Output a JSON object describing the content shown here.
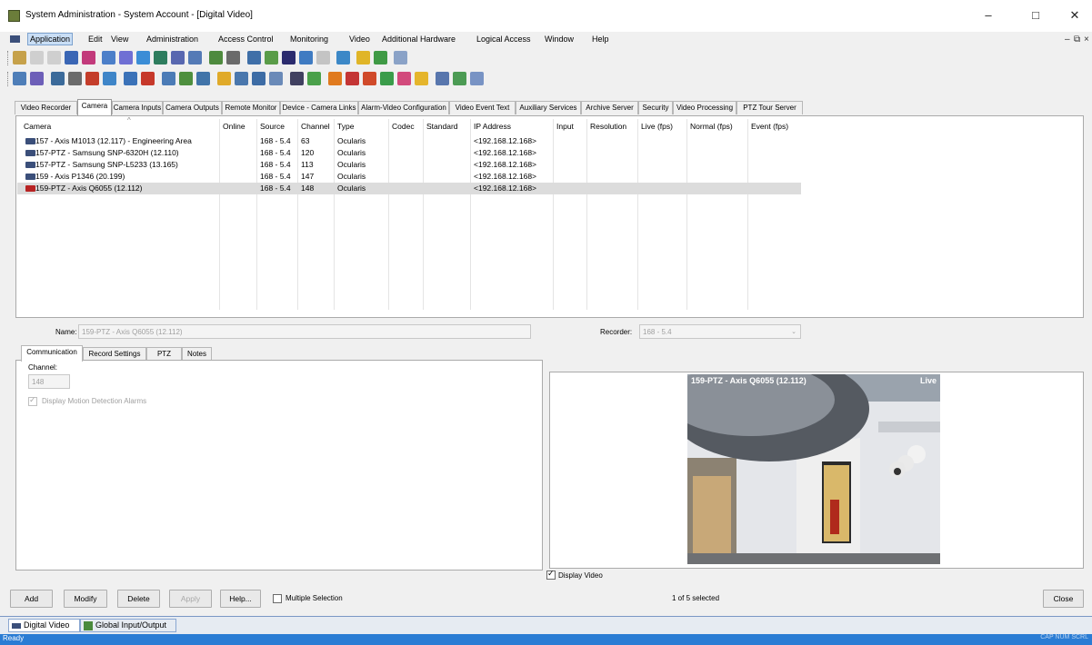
{
  "window": {
    "title": "System Administration - System Account - [Digital Video]"
  },
  "menu": [
    "Application",
    "Edit",
    "View",
    "Administration",
    "Access Control",
    "Monitoring",
    "Video",
    "Additional Hardware",
    "Logical Access",
    "Window",
    "Help"
  ],
  "tabs": [
    "Video Recorder",
    "Camera",
    "Camera Inputs",
    "Camera Outputs",
    "Remote Monitor",
    "Device - Camera Links",
    "Alarm-Video Configuration",
    "Video Event Text",
    "Auxiliary Services",
    "Archive Server",
    "Security",
    "Video Processing",
    "PTZ Tour Server"
  ],
  "table": {
    "headers": [
      "Camera",
      "Online",
      "Source",
      "Channel",
      "Type",
      "Codec",
      "Standard",
      "IP Address",
      "Input",
      "Resolution",
      "Live (fps)",
      "Normal (fps)",
      "Event (fps)"
    ],
    "rows": [
      {
        "camera": "157 - Axis M1013 (12.117) - Engineering Area",
        "source": "168 - 5.4",
        "channel": "63",
        "type": "Ocularis",
        "ip": "<192.168.12.168>"
      },
      {
        "camera": "157-PTZ - Samsung SNP-6320H (12.110)",
        "source": "168 - 5.4",
        "channel": "120",
        "type": "Ocularis",
        "ip": "<192.168.12.168>"
      },
      {
        "camera": "157-PTZ - Samsung SNP-L5233 (13.165)",
        "source": "168 - 5.4",
        "channel": "113",
        "type": "Ocularis",
        "ip": "<192.168.12.168>"
      },
      {
        "camera": "159 - Axis P1346 (20.199)",
        "source": "168 - 5.4",
        "channel": "147",
        "type": "Ocularis",
        "ip": "<192.168.12.168>"
      },
      {
        "camera": "159-PTZ - Axis Q6055 (12.112)",
        "source": "168 - 5.4",
        "channel": "148",
        "type": "Ocularis",
        "ip": "<192.168.12.168>"
      }
    ]
  },
  "details": {
    "name_label": "Name:",
    "name_value": "159-PTZ - Axis Q6055 (12.112)",
    "recorder_label": "Recorder:",
    "recorder_value": "168 - 5.4",
    "subtabs": [
      "Communication",
      "Record Settings",
      "PTZ",
      "Notes"
    ],
    "channel_label": "Channel:",
    "channel_value": "148",
    "motion_label": "Display Motion Detection Alarms"
  },
  "video": {
    "overlay_title": "159-PTZ - Axis Q6055 (12.112)",
    "overlay_status": "Live",
    "display_label": "Display Video"
  },
  "buttons": {
    "add": "Add",
    "modify": "Modify",
    "delete": "Delete",
    "apply": "Apply",
    "help": "Help...",
    "multiple": "Multiple Selection",
    "selection_count": "1 of 5 selected",
    "close": "Close"
  },
  "bottom_tabs": [
    "Digital Video",
    "Global Input/Output"
  ],
  "status": {
    "text": "Ready",
    "indicators": "CAP NUM SCRL"
  }
}
